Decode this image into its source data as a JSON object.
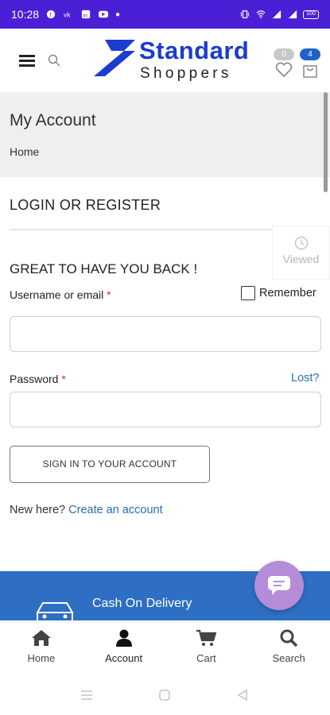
{
  "status_bar": {
    "time": "10:28",
    "battery": "100"
  },
  "header": {
    "logo_line1": "Standard",
    "logo_line2": "Shoppers",
    "wishlist_count": "0",
    "cart_count": "4"
  },
  "page": {
    "title": "My Account",
    "breadcrumb": "Home"
  },
  "viewed_widget": {
    "label": "Viewed"
  },
  "login": {
    "section_title": "LOGIN OR REGISTER",
    "welcome": "GREAT TO HAVE YOU BACK !",
    "username_label": "Username or email",
    "required_mark": "*",
    "remember_label": "Remember",
    "username_value": "",
    "password_label": "Password",
    "lost_link": "Lost?",
    "password_value": "",
    "signin_button": "SIGN IN TO YOUR ACCOUNT",
    "new_here": "New here?",
    "create_account": "Create an account"
  },
  "promo": {
    "cod_text": "Cash On Delivery"
  },
  "bottom_nav": {
    "items": [
      {
        "label": "Home",
        "icon": "home-icon"
      },
      {
        "label": "Account",
        "icon": "user-icon"
      },
      {
        "label": "Cart",
        "icon": "cart-icon"
      },
      {
        "label": "Search",
        "icon": "search-icon"
      }
    ],
    "active": "Account"
  },
  "colors": {
    "status_bar": "#4b1fd6",
    "brand_blue": "#1a3ccf",
    "link": "#2a6cb5",
    "promo_band": "#2e6fc3",
    "chat_button": "#b48cd8"
  }
}
